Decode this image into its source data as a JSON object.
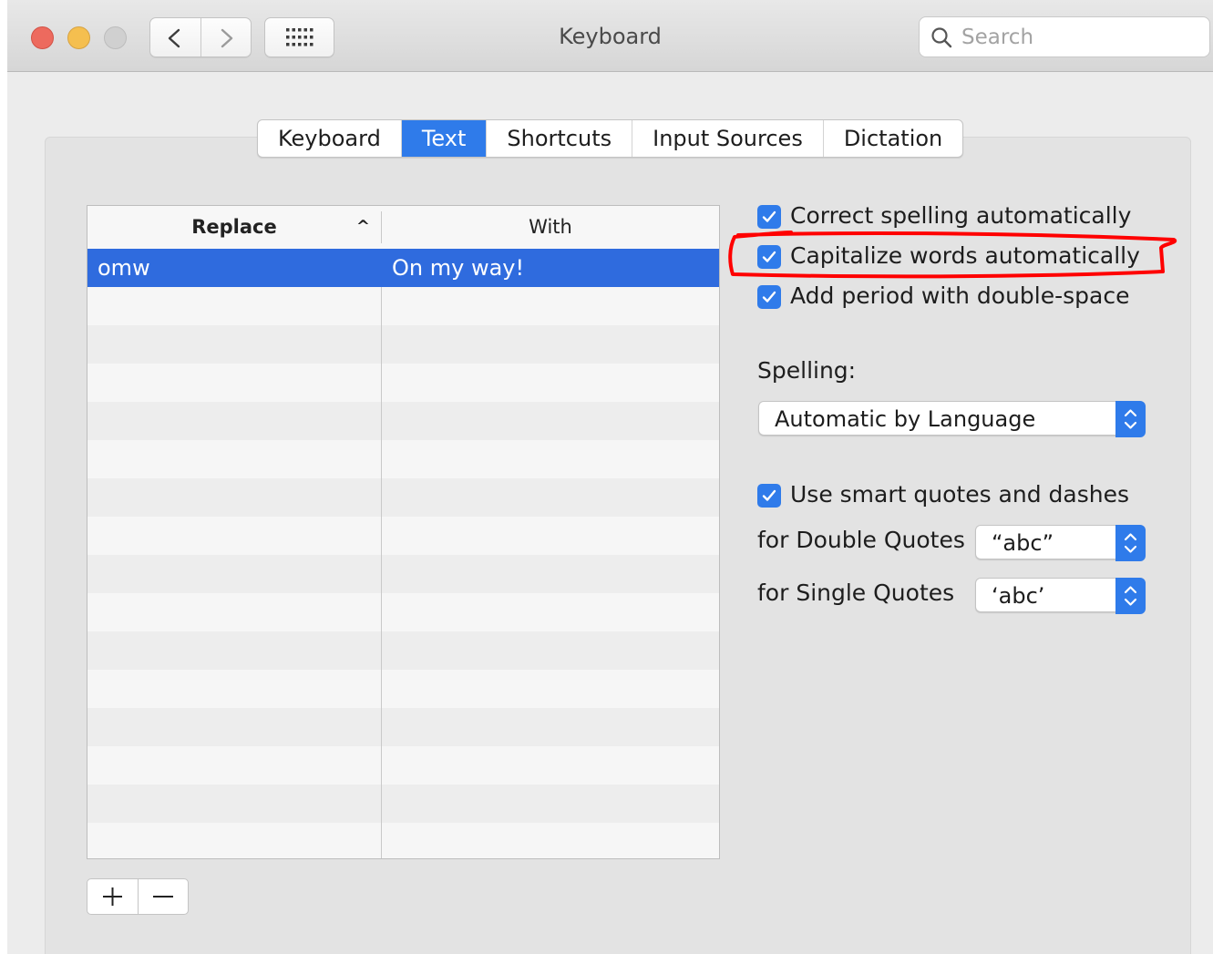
{
  "window": {
    "title": "Keyboard",
    "search_placeholder": "Search",
    "icons": {
      "back": "chevron-left-icon",
      "forward": "chevron-right-icon",
      "show_all": "grid-icon",
      "search": "magnifier-icon"
    }
  },
  "tabs": [
    {
      "label": "Keyboard",
      "active": false
    },
    {
      "label": "Text",
      "active": true
    },
    {
      "label": "Shortcuts",
      "active": false
    },
    {
      "label": "Input Sources",
      "active": false
    },
    {
      "label": "Dictation",
      "active": false
    }
  ],
  "table": {
    "columns": {
      "replace": "Replace",
      "with": "With"
    },
    "sort_indicator": "^",
    "rows": [
      {
        "replace": "omw",
        "with": "On my way!",
        "selected": true
      }
    ]
  },
  "buttons": {
    "add": "+",
    "remove": "−"
  },
  "options": {
    "correct_spelling": {
      "label": "Correct spelling automatically",
      "checked": true
    },
    "capitalize_words": {
      "label": "Capitalize words automatically",
      "checked": true
    },
    "add_period": {
      "label": "Add period with double-space",
      "checked": true
    }
  },
  "spelling": {
    "label": "Spelling:",
    "value": "Automatic by Language"
  },
  "smart_quotes": {
    "label": "Use smart quotes and dashes",
    "checked": true,
    "double_label": "for Double Quotes",
    "double_value": "“abc”",
    "single_label": "for Single Quotes",
    "single_value": "‘abc’"
  },
  "colors": {
    "accent": "#2f7bea",
    "selection": "#2f6bde",
    "annotation": "#ff0000"
  }
}
